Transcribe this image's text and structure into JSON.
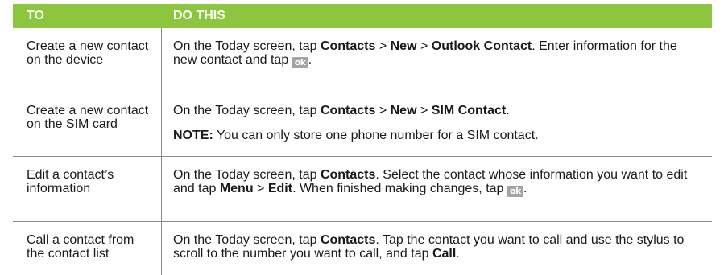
{
  "header": {
    "col1": "TO",
    "col2": "DO THIS"
  },
  "ok_icon_text": "ok",
  "rows": [
    {
      "to": "Create a new contact on the device",
      "p1": [
        "On the Today screen, tap ",
        "Contacts",
        " > ",
        "New",
        " > ",
        "Outlook Contact",
        ". Enter information for the new contact and tap ",
        "."
      ]
    },
    {
      "to": "Create a new contact on the SIM card",
      "p1": [
        "On the Today screen, tap ",
        "Contacts",
        " > ",
        "New",
        " > ",
        "SIM Contact",
        "."
      ],
      "p2": [
        "NOTE:",
        " You can only store one phone number for a SIM contact."
      ]
    },
    {
      "to": "Edit a contact’s information",
      "p1": [
        "On the Today screen, tap ",
        "Contacts",
        ". Select the contact whose information you want to edit and tap ",
        "Menu",
        " > ",
        "Edit",
        ". When finished making changes, tap ",
        "."
      ]
    },
    {
      "to": "Call a contact from the contact list",
      "p1": [
        "On the Today screen, tap ",
        "Contacts",
        ". Tap the contact you want to call and use the stylus to scroll to the number you want to call, and tap ",
        "Call",
        "."
      ]
    }
  ]
}
